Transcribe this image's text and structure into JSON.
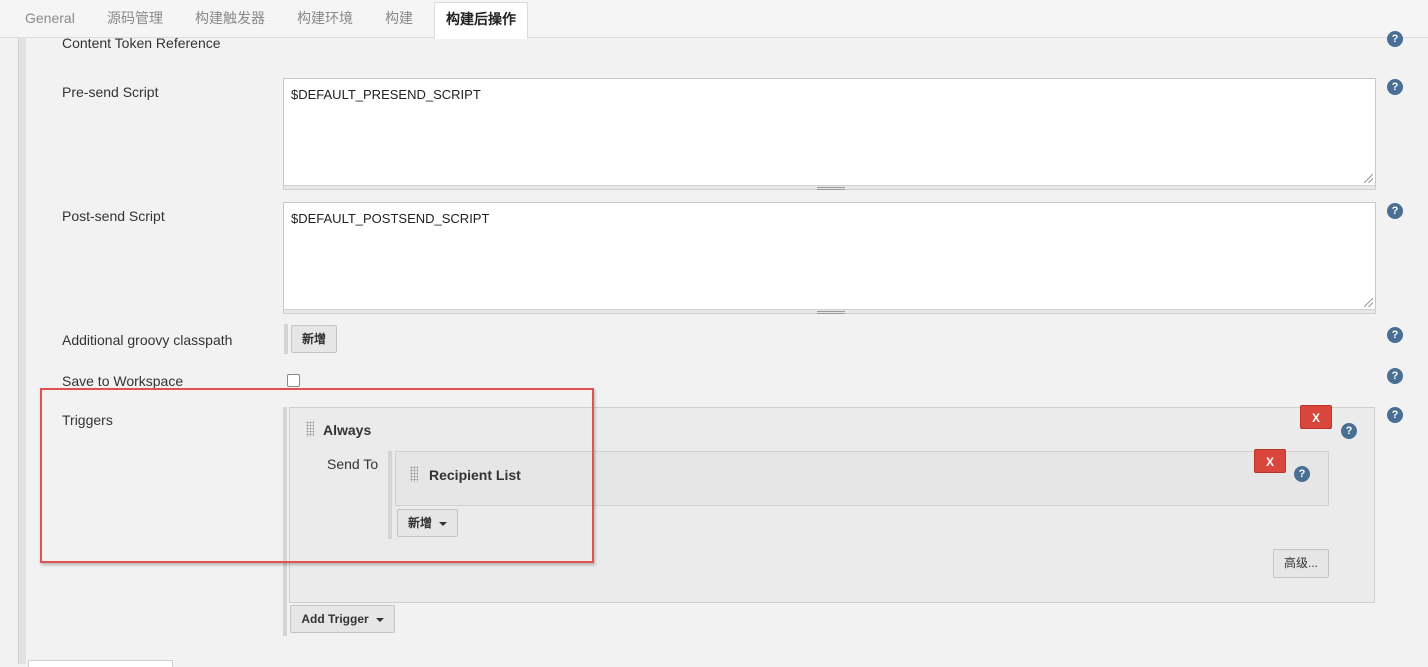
{
  "tabs": [
    {
      "label": "General",
      "active": false
    },
    {
      "label": "源码管理",
      "active": false
    },
    {
      "label": "构建触发器",
      "active": false
    },
    {
      "label": "构建环境",
      "active": false
    },
    {
      "label": "构建",
      "active": false
    },
    {
      "label": "构建后操作",
      "active": true
    }
  ],
  "form": {
    "content_token_label": "Content Token Reference",
    "presend_label": "Pre-send Script",
    "presend_value": "$DEFAULT_PRESEND_SCRIPT",
    "postsend_label": "Post-send Script",
    "postsend_value": "$DEFAULT_POSTSEND_SCRIPT",
    "groovy_label": "Additional groovy classpath",
    "groovy_add_button": "新增",
    "save_workspace_label": "Save to Workspace",
    "save_workspace_checked": false,
    "triggers_label": "Triggers"
  },
  "trigger": {
    "title": "Always",
    "delete_label": "X",
    "send_to_label": "Send To",
    "recipient_title": "Recipient List",
    "recipient_delete_label": "X",
    "add_dropdown_label": "新增",
    "advanced_button": "高级..."
  },
  "add_trigger_button": "Add Trigger",
  "help_glyph": "?",
  "colors": {
    "danger": "#d9463b",
    "help": "#4a6f94",
    "highlight_frame": "#e05252"
  }
}
